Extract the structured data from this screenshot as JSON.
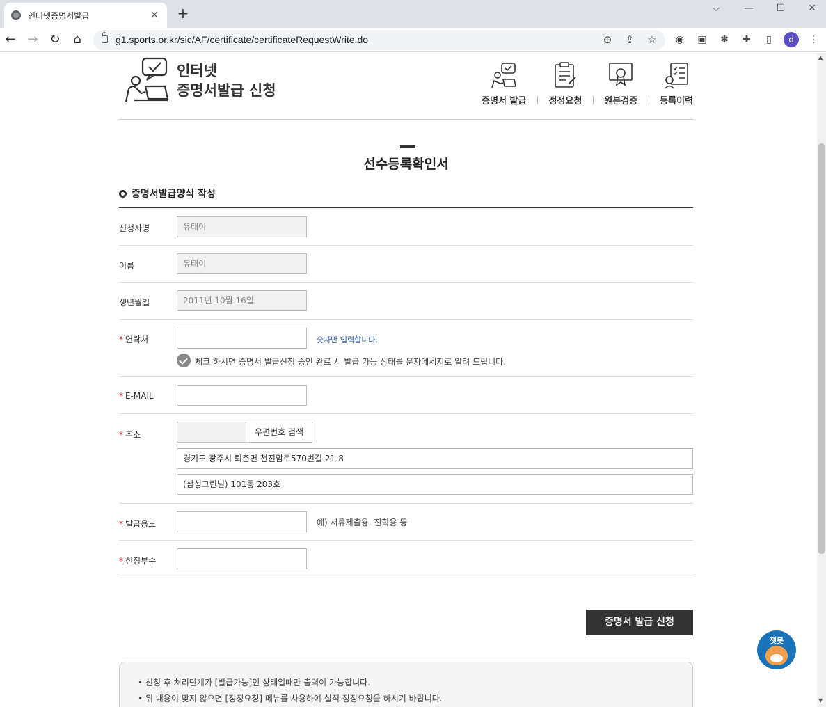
{
  "browser": {
    "tab_title": "인터넷증명서발급",
    "tab_close": "✕",
    "new_tab": "+",
    "url": "g1.sports.or.kr/sic/AF/certificate/certificateRequestWrite.do",
    "profile_initial": "d"
  },
  "header": {
    "brand_line1": "인터넷",
    "brand_line2": "증명서발급 신청",
    "nav": [
      {
        "label": "증명서 발급"
      },
      {
        "label": "정정요청"
      },
      {
        "label": "원본검증"
      },
      {
        "label": "등록이력"
      }
    ]
  },
  "page": {
    "title": "선수등록확인서",
    "section_title": "증명서발급양식 작성"
  },
  "form": {
    "applicant": {
      "label": "신청자명",
      "value": "유태이"
    },
    "name": {
      "label": "이름",
      "value": "유태이"
    },
    "birth": {
      "label": "생년월일",
      "value": "2011년 10월 16일"
    },
    "phone": {
      "required": "*",
      "label": "연락처",
      "value": "",
      "hint": "숫자만 입력합니다.",
      "sms_notice": "체크 하시면 증명서 발급신청 승인 완료 시 발급 가능 상태를 문자메세지로 알려 드립니다."
    },
    "email": {
      "required": "*",
      "label": "E-MAIL",
      "value": ""
    },
    "address": {
      "required": "*",
      "label": "주소",
      "zip": "",
      "zip_button": "우편번호 검색",
      "line1": "경기도 광주시 퇴촌면 천진암로570번길 21-8",
      "line2": "(삼성그린빌) 101동 203호"
    },
    "purpose": {
      "required": "*",
      "label": "발급용도",
      "value": "",
      "example": "예) 서류제출용, 진학용 등"
    },
    "copies": {
      "required": "*",
      "label": "신청부수",
      "value": ""
    }
  },
  "submit_label": "증명서 발급 신청",
  "notices": [
    "신청 후 처리단계가 [발급가능]인 상태일때만 출력이 가능합니다.",
    "위 내용이 맞지 않으면 [정정요청] 메뉴를 사용하여 실적 정정요청을 하시기 바랍니다."
  ],
  "chatbot_label": "챗봇"
}
